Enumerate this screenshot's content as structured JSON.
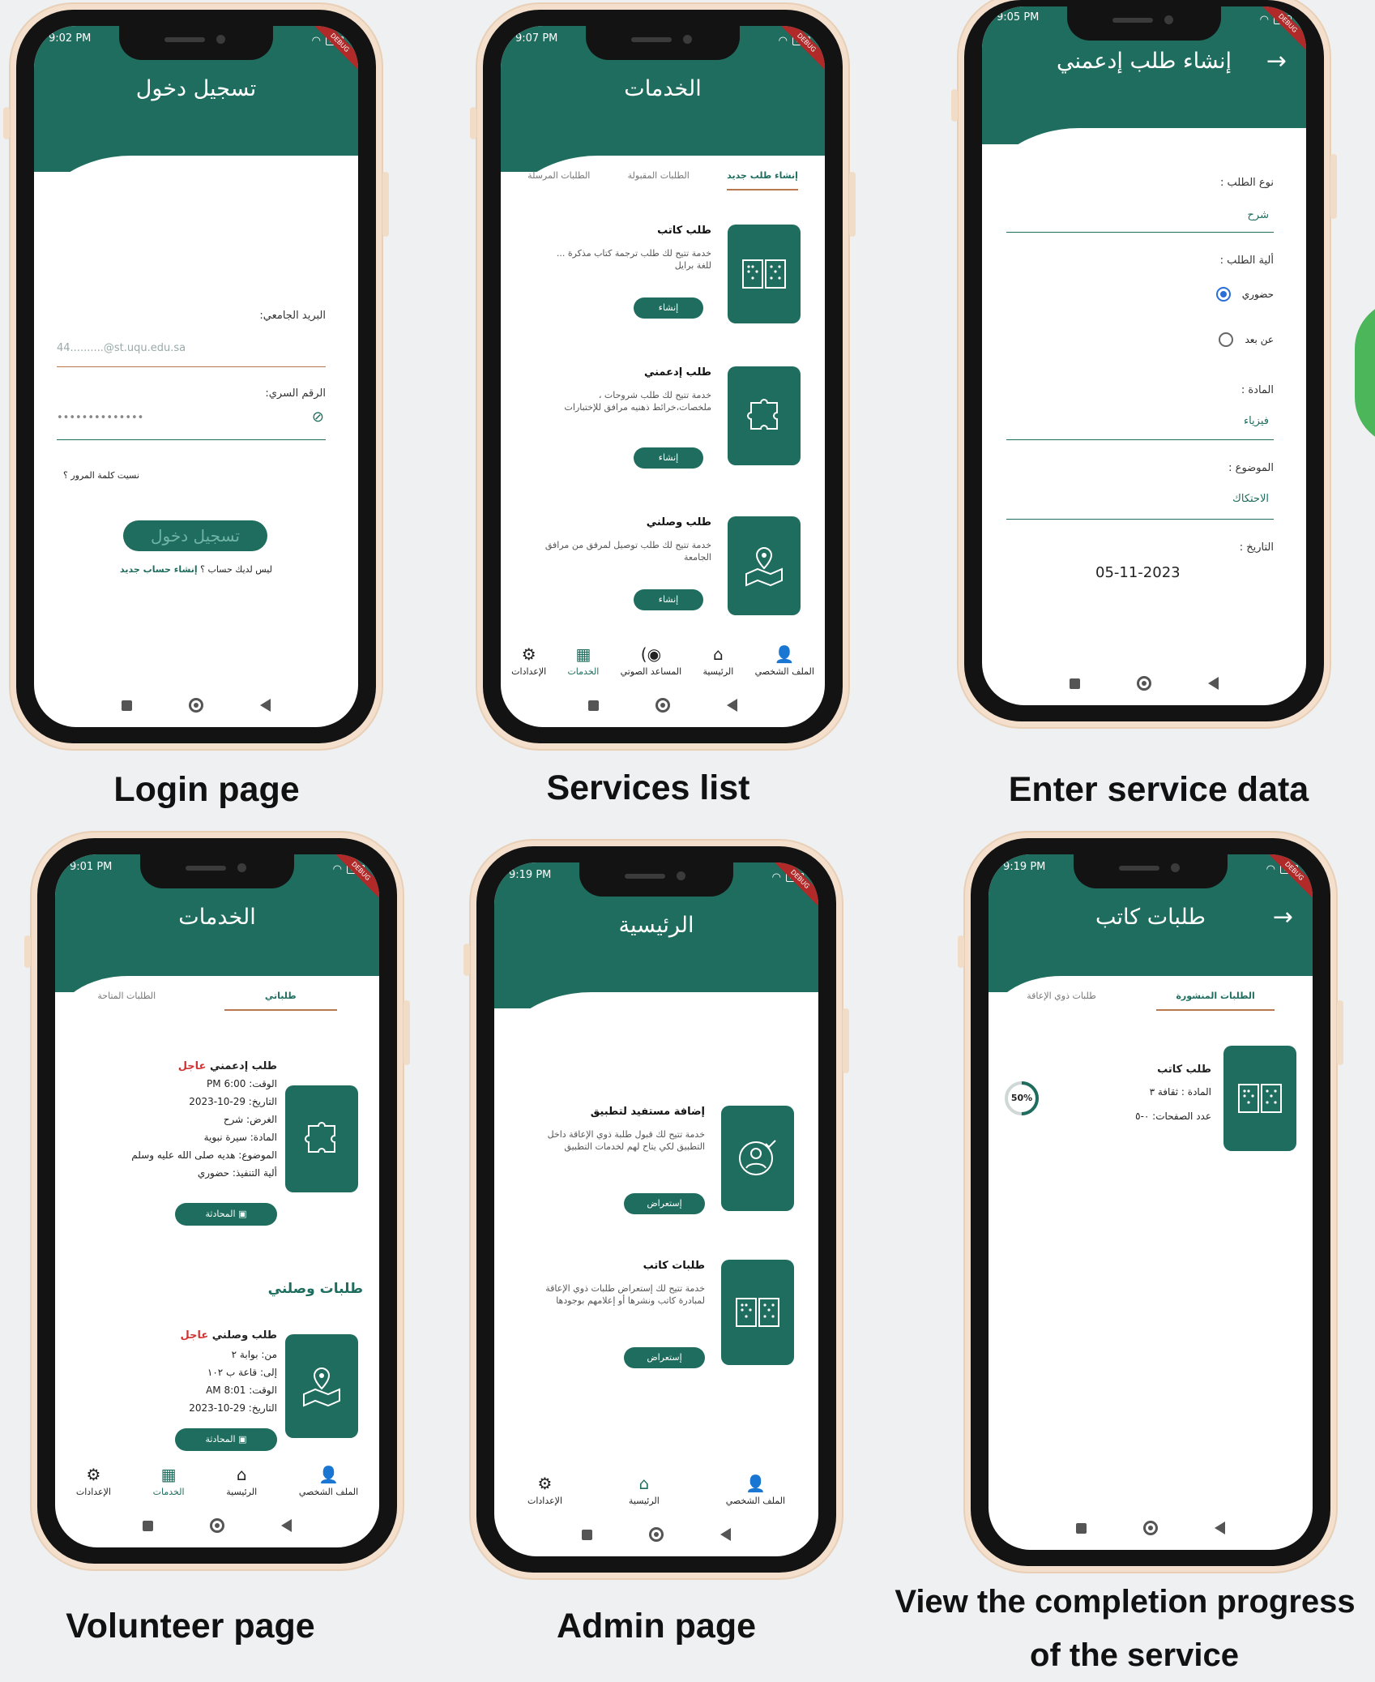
{
  "status": {
    "p1_time": "9:02 PM",
    "p2_time": "9:07 PM",
    "p3_time": "9:05 PM",
    "p4_time": "9:01 PM",
    "p5_time": "9:19 PM",
    "p6_time": "9:19 PM",
    "battery": "116"
  },
  "login": {
    "title": "تسجيل دخول",
    "email_label": "البريد الجامعي:",
    "email_placeholder": "44..........@st.uqu.edu.sa",
    "password_label": "الرقم السري:",
    "password_value": "••••••••••••••",
    "forgot": "نسيت كلمة المرور ؟",
    "login_button": "تسجيل دخول",
    "signup_text": "ليس لديك حساب ؟",
    "signup_link": "إنشاء حساب جديد",
    "caption": "Login page"
  },
  "services": {
    "title": "الخدمات",
    "tabs": [
      "إنشاء طلب جديد",
      "الطلبات المقبولة",
      "الطلبات المرسلة"
    ],
    "cards": [
      {
        "title": "طلب كاتب",
        "desc": "خدمة تتيح لك طلب ترجمة كتاب مذكرة ... للغة برايل",
        "action": "إنشاء"
      },
      {
        "title": "طلب إدعمني",
        "desc": "خدمة تتيح لك طلب شروحات ، ملخصات،خرائط ذهنيه مرافق للإختبارات",
        "action": "إنشاء"
      },
      {
        "title": "طلب وصلني",
        "desc": "خدمة تتيح لك طلب توصيل لمرفق من مرافق الجامعة",
        "action": "إنشاء"
      }
    ],
    "nav": [
      "الملف الشخصي",
      "الرئيسية",
      "المساعد الصوتي",
      "الخدمات",
      "الإعدادات"
    ],
    "caption": "Services list"
  },
  "create": {
    "title": "إنشاء طلب إدعمني",
    "type_label": "نوع الطلب :",
    "type_value": "شرح",
    "mechanism_label": "ألية الطلب :",
    "option_inperson": "حضوري",
    "option_remote": "عن بعد",
    "subject_label": "المادة :",
    "subject_value": "فيزياء",
    "topic_label": "الموضوع :",
    "topic_value": "الاحتكاك",
    "date_label": "التاريخ :",
    "date_value": "05-11-2023",
    "caption": "Enter  service data"
  },
  "volunteer": {
    "title": "الخدمات",
    "tabs": [
      "طلباتي",
      "الطلبات المتاحة"
    ],
    "req1": {
      "title": "طلب  إدعمني",
      "urgent": "عاجل",
      "time": "الوقت: 6:00 PM",
      "date": "التاريخ: 29-10-2023",
      "purpose": "الغرض: شرح",
      "subject": "المادة: سيرة نبوية",
      "topic": "الموضوع: هديه صلى الله عليه وسلم",
      "mechanism": "ألية التنفيذ: حضوري",
      "chat": "المحادثة"
    },
    "section2": "طلبات وصلني",
    "req2": {
      "title": "طلب  وصلني",
      "urgent": "عاجل",
      "from": "من: بوابة ٢",
      "to": "إلى: قاعة ب ١٠٢",
      "time": "الوقت: 8:01 AM",
      "date": "التاريخ: 29-10-2023",
      "chat": "المحادثة"
    },
    "nav": [
      "الملف الشخصي",
      "الرئيسية",
      "الخدمات",
      "الإعدادات"
    ],
    "caption": "Volunteer page"
  },
  "admin": {
    "title": "الرئيسية",
    "cards": [
      {
        "title": "إضافة مستفيد لتطبيق",
        "desc": "خدمة تتيح لك قبول طلبة ذوي الإعاقة داخل التطبيق لكي يتاح لهم لخدمات التطبيق",
        "action": "إستعراض"
      },
      {
        "title": "طلبات كاتب",
        "desc": "خدمة تتيح لك إستعراض طلبات ذوي الإعاقة لمبادرة كاتب ونشرها أو إعلامهم بوجودها",
        "action": "إستعراض"
      }
    ],
    "nav": [
      "الملف الشخصي",
      "الرئيسية",
      "الإعدادات"
    ],
    "caption": "Admin page"
  },
  "progress": {
    "title": "طلبات كاتب",
    "tabs": [
      "الطلبات المنشورة",
      "طلبات ذوي الإعاقة"
    ],
    "card_title": "طلب كاتب",
    "subject": "المادة : ثقافة ٣",
    "pages": "عدد الصفحات: ٠-٥",
    "percent": "50%",
    "percent_value": 50,
    "caption_line1": "View the completion progress",
    "caption_line2": "of the service"
  },
  "colors": {
    "primary": "#1f6d5e",
    "accent": "#b8774d",
    "urgent": "#d13333",
    "frame": "#131313"
  }
}
